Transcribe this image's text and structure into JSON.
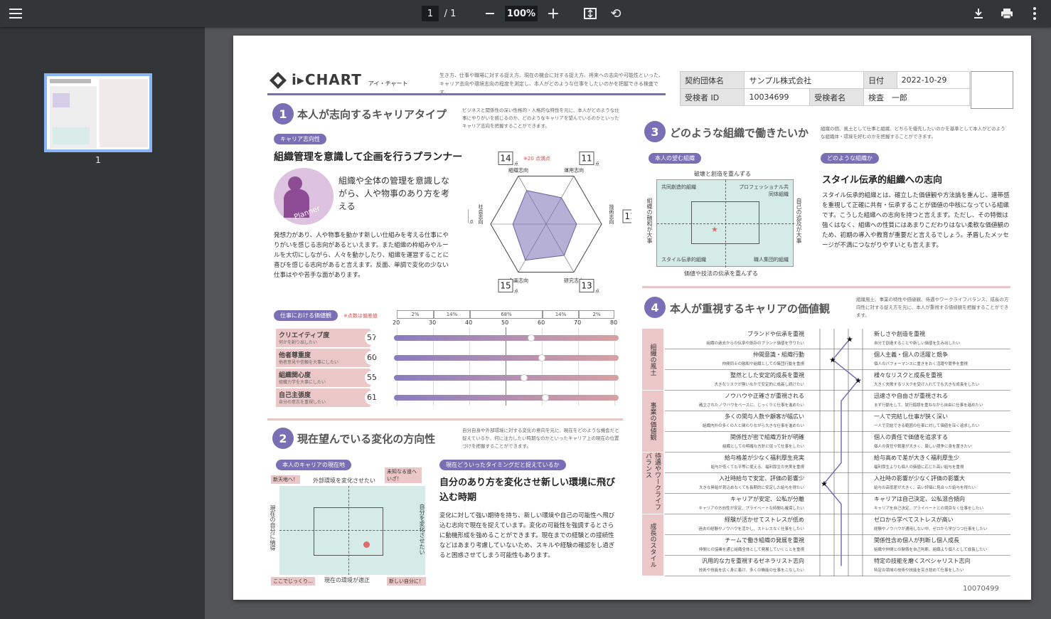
{
  "toolbar": {
    "page_current": "1",
    "page_total": "/ 1",
    "zoom": "100%"
  },
  "sidebar": {
    "thumb_label": "1"
  },
  "doc": {
    "logo_text": "i▸CHART",
    "logo_kana": "アイ・チャート",
    "intro": "生き方、仕事や職場に対する捉え方、現在の機会に対する捉え方、将来への志向や可能性といった、キャリア志向や環境志向の程度を測定し、本人がどのような仕事をしたいのかを把握できる検査です。",
    "meta": {
      "org_label": "契約団体名",
      "org": "サンプル株式会社",
      "date_label": "日付",
      "date": "2022-10-29",
      "id_label": "受検者 ID",
      "id": "10034699",
      "name_label": "受検者名",
      "name": "検査　一郎"
    },
    "s1": {
      "num": "1",
      "title": "本人が志向するキャリアタイプ",
      "desc": "ビジネスと関係性の深い性格的・人格的な特性を元に、本人がどのような仕事にやりがいを感じるのか、どのようなキャリアを望んでいるのかといったキャリア志向を把握することができます。",
      "pill": "キャリア志向性",
      "headline": "組織管理を意識して企画を行うプランナー",
      "lead": "組織や全体の管理を意識しながら、人や物事のあり方を考える",
      "body": "発想力があり、人や物事を動かす新しい仕組みを考える仕事にやりがいを感じる志向があるといえます。また組織の枠組みやルールを大切にしながら、人々を動かしたり、組織を運営することに喜びを感じる志向があると言えます。反面、単調で変化の少ない仕事はやや苦手な面があります。",
      "planner": "Planner",
      "full": "※20 点満点",
      "pt": "点",
      "radar_labels": [
        "組織志向",
        "運用志向",
        "技術志向",
        "研究志向",
        "企画志向",
        "社会志向"
      ],
      "radar_values": [
        14,
        11,
        11,
        13,
        15,
        12
      ]
    },
    "values": {
      "pill": "仕事における価値観",
      "note": "※点数は偏差値",
      "pct": [
        "2%",
        "14%",
        "68%",
        "14%",
        "2%"
      ],
      "ticks": [
        "20",
        "30",
        "40",
        "50",
        "60",
        "70",
        "80"
      ],
      "rows": [
        {
          "name": "クリエイティブ度",
          "sub": "何かを創り出したい",
          "score": "57"
        },
        {
          "name": "他者尊重度",
          "sub": "他者意見や信頼を大事にしたい",
          "score": "60"
        },
        {
          "name": "組織関心度",
          "sub": "組織力学を大事にしたい",
          "score": "55"
        },
        {
          "name": "自己主張度",
          "sub": "自分の意志を重視したい",
          "score": "61"
        }
      ]
    },
    "s2": {
      "num": "2",
      "title": "現在望んでいる変化の方向性",
      "desc": "自分自身や外部環境に対する変化の意向を元に、現在をどのような機会だと捉えているか、何に注力したい時期なのかといったキャリア上の現在の位置づけを把握することができます。",
      "pill1": "本人のキャリアの現在地",
      "pill2": "現在どういったタイミングだと捉えているか",
      "top": "外部環境を変化させたい",
      "bottom": "現在の環境が適正",
      "left": "現在の自分に納得",
      "right": "自分を変化させたい",
      "c1": "新天地へ！",
      "c2": "未知なる道へいざ！",
      "c3": "ここでじっくり…",
      "c4": "新しい自分に！",
      "headline": "自分のあり方を変化させ新しい環境に飛び込む時期",
      "body": "変化に対して強い期待を持ち、新しい環境や自己の可能性へ飛び込む志向で現在を捉えています。変化の可能性を強調するとさらに動機形成を強めることができます。現在までの経験との接続性などはあまり考慮していないため、スキルや経験の確認をし過ぎると困惑させてしまう可能性もあります。"
    },
    "s3": {
      "num": "3",
      "title": "どのような組織で働きたいか",
      "desc": "組織の個、風土として仕事と組織、どちらを優先したいのかを基準として本人がどのような組織体・環境を好むのかを把握することができます。",
      "pill1": "本人の望む組織",
      "pill2": "どのような組織か",
      "top": "破壊と創造を重んずる",
      "bottom": "価値や技法の伝承を重んずる",
      "left": "組織の融和が大事",
      "right": "自己の追及が大事",
      "q1": "共同創造的組織",
      "q2": "プロフェッショナル共同体組織",
      "q3": "スタイル伝承的組織",
      "q4": "職人集団的組織",
      "headline": "スタイル伝承的組織への志向",
      "body": "スタイル伝承的組織とは、確立した価値観や方法論を重んじ、連帯感を重視して正確に共有・伝承することが価値の中核になっている組織です。こうした組織への志向を持つと言えます。ただし、その特徴は強くはなく、組織への性質にはあまりこだわりはない柔軟な価値観のため、初期の導入や教育が重要だと言えるでしょう。矛盾したメッセージが不満につながりやすいとも言えます。"
    },
    "s4": {
      "num": "4",
      "title": "本人が重視するキャリアの価値観",
      "desc": "組織風土、事業の特性や価値観、待遇やワークライフバランス、成長の方向性に対する捉え方を元に、本人が重視する価値観を把握することができます。",
      "cats": [
        "組織の風土",
        "事業の価値観",
        "待遇やワークライフバランス",
        "成長のスタイル"
      ],
      "rows": [
        {
          "l": "ブランドや伝承を重視",
          "ls": "組織の過去からの伝承や既存のブランド価値を守りたい",
          "r": "新しさや創造を重視",
          "rs": "自分で創造することや新しい価値を生み出したい"
        },
        {
          "l": "仲間意識・組織行動",
          "ls": "仲間同士の融和や組織としての集団行動を重視",
          "r": "個人主義・個人の活躍と競争",
          "rs": "個人のパフォーマンスに重きをおく活躍や競争を重視"
        },
        {
          "l": "整然とした安定的成長を重視",
          "ls": "大きなリスクが無いなかで安定的に成長し続けたい",
          "r": "様々なリスクと成長を重視",
          "rs": "大きく失敗するリスクを受け入れてでも大きな成長をしたい"
        },
        {
          "l": "ノウハウや正確さが重視される",
          "ls": "確立されたノウハウをベースに、じっくりと仕事を進めたい",
          "r": "迅速さや自由さが重視される",
          "rs": "まず行動をして、試行錯誤を重ねながら自由に仕事を進めたい"
        },
        {
          "l": "多くの関与人数や顧客が幅広い",
          "ls": "組織内外の多くの人と関わりながら大きな仕事を進めたい",
          "r": "一人で完結し仕事が狭く深い",
          "rs": "一人で完結できる範囲の仕事に対して価値を深く追求したい"
        },
        {
          "l": "関係性が密で組織方針が明確",
          "ls": "組織としての明確な方針に従って仕事をしたい",
          "r": "個人の責任で価値を追求する",
          "rs": "個人の責任や裁量が大きく、厳しい競争に身を置きたい"
        },
        {
          "l": "給与格差が少なく福利厚生充実",
          "ls": "給与が低くても平等に使える、福利厚生の充実を重視",
          "r": "給与高めで差が大きく福利厚生少",
          "rs": "福利厚生よりも個人の価値に応じた高い給与を重視"
        },
        {
          "l": "入社時給与で安定、評価の影響少",
          "ls": "大きな昇給が見込めなくても長期的に安定した給与を得たい",
          "r": "入社時の影響が少なく評価の影響大",
          "rs": "給与の高低差が大きく、高い評価に見合った給与を得たい"
        },
        {
          "l": "キャリアが安定、公私が分離",
          "ls": "キャリアの方向性が安定、プライベートな時間も確保したい",
          "r": "キャリアは自己決定、公私混合傾向",
          "rs": "キャリアを自己決定、プライベートとの境目なく仕事をしたい"
        },
        {
          "l": "経験が活かせてストレスが低め",
          "ls": "過去の経験やノウハウを活かし、ストレスなく仕事をしたい",
          "r": "ゼロから学べてストレスが高い",
          "rs": "経験やノウハウが通用しない中、ゼロから学びつつ仕事をしたい"
        },
        {
          "l": "チームで働き組織の発展を重視",
          "ls": "仲間との協業を通じ組織全体として発展していくことを重視",
          "r": "関係性含め個人が判断し個人成長",
          "rs": "組織や仲間との関係を自己判断、組織より個人として成長したい"
        },
        {
          "l": "汎用的な力を重視するゼネラリスト志向",
          "ls": "技術や技能を広く身に着け、多くの機能の仕事をこなしたい",
          "r": "特定の技能を磨くスペシャリスト志向",
          "rs": "特定の領域の技術や技能を突き詰めて仕事をしたい"
        }
      ],
      "chart_values": [
        1,
        -1,
        2,
        0,
        0,
        0,
        0,
        -2,
        0,
        0,
        0,
        0
      ]
    },
    "footer_code": "10070499"
  }
}
